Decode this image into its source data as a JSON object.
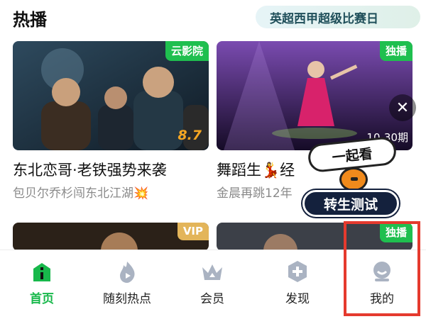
{
  "header": {
    "title": "热播",
    "banner": "英超西甲超级比赛日"
  },
  "cards": [
    {
      "tag": "云影院",
      "score": "8.7",
      "title": "东北恋哥·老铁强势来袭",
      "subtitle": "包贝尔乔杉闯东北江湖💥"
    },
    {
      "tag": "独播",
      "episode": "10-30期",
      "title": "舞蹈生💃经",
      "subtitle": "金晨再跳12年"
    },
    {
      "tag": "VIP"
    },
    {
      "tag": "独播"
    }
  ],
  "promo": {
    "top": "一起看",
    "bottom": "转生测试"
  },
  "tabs": [
    {
      "label": "首页",
      "icon": "home-icon",
      "active": true
    },
    {
      "label": "随刻热点",
      "icon": "flame-icon"
    },
    {
      "label": "会员",
      "icon": "crown-icon"
    },
    {
      "label": "发现",
      "icon": "discover-plus-icon"
    },
    {
      "label": "我的",
      "icon": "profile-icon"
    }
  ],
  "colors": {
    "accent": "#18b84b",
    "tag_green": "#1fbf4f",
    "tag_vip": "#e3b55a",
    "highlight": "#e53a2e"
  }
}
